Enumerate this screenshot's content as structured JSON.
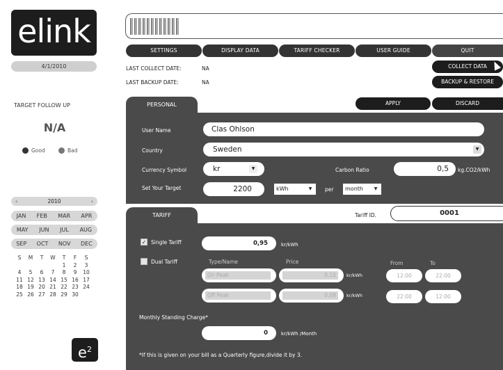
{
  "logo": "elink",
  "date": "4/1/2010",
  "target": {
    "title": "TARGET FOLLOW UP",
    "value": "N/A",
    "good": "Good",
    "bad": "Bad",
    "good_color": "#333333",
    "bad_color": "#777777"
  },
  "calendar": {
    "year": "2010",
    "prev": "‹",
    "next": "›",
    "months": [
      [
        "JAN",
        "FEB",
        "MAR",
        "APR"
      ],
      [
        "MAY",
        "JUN",
        "JUL",
        "AUG"
      ],
      [
        "SEP",
        "OCT",
        "NOV",
        "DEC"
      ]
    ],
    "weekdays": [
      "S",
      "M",
      "T",
      "W",
      "T",
      "F",
      "S"
    ],
    "weeks": [
      [
        "",
        "",
        "",
        "",
        "1",
        "2",
        "3"
      ],
      [
        "4",
        "5",
        "6",
        "7",
        "8",
        "9",
        "10"
      ],
      [
        "11",
        "12",
        "13",
        "14",
        "15",
        "16",
        "17"
      ],
      [
        "18",
        "19",
        "20",
        "21",
        "22",
        "23",
        "24"
      ],
      [
        "25",
        "26",
        "27",
        "28",
        "29",
        "30",
        ""
      ]
    ]
  },
  "brand_badge": {
    "base": "e",
    "sup": "2"
  },
  "nav": [
    "SETTINGS",
    "DISPLAY DATA",
    "TARIFF CHECKER",
    "USER GUIDE",
    "QUIT"
  ],
  "info": {
    "last_collect_label": "LAST COLLECT DATE:",
    "last_collect_value": "NA",
    "last_backup_label": "LAST BACKUP DATE:",
    "last_backup_value": "NA"
  },
  "actions": {
    "collect": "COLLECT DATA",
    "backup": "BACKUP & RESTORE",
    "apply": "APPLY",
    "discard": "DISCARD"
  },
  "personal": {
    "tab": "PERSONAL",
    "user_name_label": "User Name",
    "user_name": "Clas Ohlson",
    "country_label": "Country",
    "country": "Sweden",
    "currency_label": "Currency Symbol",
    "currency": "kr",
    "carbon_label": "Carbon Ratio",
    "carbon_value": "0,5",
    "carbon_unit": "kg.CO2/kWh",
    "target_label": "Set Your Target",
    "target_value": "2200",
    "target_unit": "kWh",
    "per": "per",
    "period": "month"
  },
  "tariff": {
    "tab": "TARIFF",
    "id_label": "Tariff ID.",
    "id_value": "0001",
    "single_label": "Single Tariff",
    "single_checked": "✓",
    "single_value": "0,95",
    "single_unit": "kr/kWh",
    "dual_label": "Dual Tariff",
    "col_type": "Type/Name",
    "col_price": "Price",
    "col_from": "From",
    "col_to": "To",
    "on_peak": "On Peak",
    "on_price": "0,15",
    "on_unit": "kr/kWh",
    "on_from": "12:00",
    "on_to": "22:00",
    "off_peak": "Off Peak",
    "off_price": "0,08",
    "off_unit": "kr/kWh",
    "off_from": "22:00",
    "off_to": "12:00",
    "standing_label": "Monthly Standing Charge*",
    "standing_value": "0",
    "standing_unit": "kr/kWh /Month",
    "note": "*If this is given on your bill as a Quarterly figure,divide it by 3."
  }
}
